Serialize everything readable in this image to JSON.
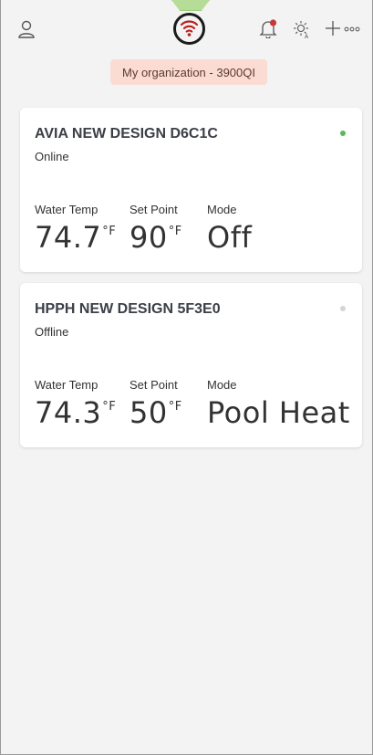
{
  "header": {
    "icons": [
      "user-icon",
      "logo-icon",
      "bell-icon",
      "sun-icon",
      "plus-icon",
      "more-icon"
    ],
    "notification_color": "#c43a3a",
    "logo_color": "#b8201c"
  },
  "organization": {
    "label": "My organization - 3900QI"
  },
  "devices": [
    {
      "name": "AVIA NEW DESIGN D6C1C",
      "status": "Online",
      "status_color": "#5cb85c",
      "metrics": [
        {
          "label": "Water Temp",
          "value": "74.7",
          "unit": "°F"
        },
        {
          "label": "Set Point",
          "value": "90",
          "unit": "°F"
        },
        {
          "label": "Mode",
          "value": "Off",
          "unit": ""
        }
      ]
    },
    {
      "name": "HPPH NEW DESIGN 5F3E0",
      "status": "Offline",
      "status_color": "#d6d6d6",
      "metrics": [
        {
          "label": "Water Temp",
          "value": "74.3",
          "unit": "°F"
        },
        {
          "label": "Set Point",
          "value": "50",
          "unit": "°F"
        },
        {
          "label": "Mode",
          "value": "Pool Heat",
          "unit": ""
        }
      ]
    }
  ]
}
